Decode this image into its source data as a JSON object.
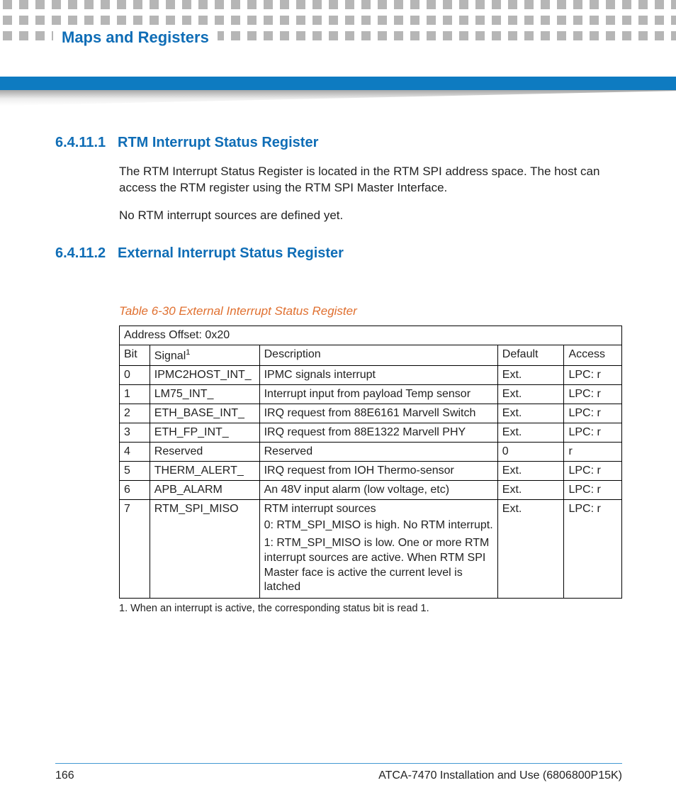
{
  "header": {
    "section_title": "Maps and Registers"
  },
  "sections": [
    {
      "number": "6.4.11.1",
      "title": "RTM Interrupt Status Register",
      "paragraphs": [
        "The RTM Interrupt Status Register is located in the RTM SPI address space. The host can access the RTM register using the RTM SPI Master Interface.",
        "No RTM interrupt sources are defined yet."
      ]
    },
    {
      "number": "6.4.11.2",
      "title": "External Interrupt Status Register",
      "paragraphs": []
    }
  ],
  "table": {
    "caption": "Table 6-30 External Interrupt Status Register",
    "address_offset": "Address Offset: 0x20",
    "columns": {
      "bit": "Bit",
      "signal": "Signal",
      "signal_sup": "1",
      "description": "Description",
      "default": "Default",
      "access": "Access"
    },
    "rows": [
      {
        "bit": "0",
        "signal": "IPMC2HOST_INT_",
        "description": "IPMC signals interrupt",
        "default": "Ext.",
        "access": "LPC: r"
      },
      {
        "bit": "1",
        "signal": "LM75_INT_",
        "description": "Interrupt input from payload Temp sensor",
        "default": "Ext.",
        "access": "LPC: r"
      },
      {
        "bit": "2",
        "signal": "ETH_BASE_INT_",
        "description": "IRQ request from 88E6161 Marvell Switch",
        "default": "Ext.",
        "access": "LPC: r"
      },
      {
        "bit": "3",
        "signal": "ETH_FP_INT_",
        "description": "IRQ request from 88E1322 Marvell PHY",
        "default": "Ext.",
        "access": "LPC: r"
      },
      {
        "bit": "4",
        "signal": "Reserved",
        "description": "Reserved",
        "default": "0",
        "access": " r"
      },
      {
        "bit": "5",
        "signal": "THERM_ALERT_",
        "description": "IRQ request from IOH Thermo-sensor",
        "default": "Ext.",
        "access": "LPC: r"
      },
      {
        "bit": "6",
        "signal": "APB_ALARM",
        "description": "An 48V input alarm (low voltage, etc)",
        "default": "Ext.",
        "access": "LPC: r"
      },
      {
        "bit": "7",
        "signal": "RTM_SPI_MISO",
        "description": "RTM interrupt sources",
        "sub1": "0: RTM_SPI_MISO is high. No RTM interrupt.",
        "sub2": "1: RTM_SPI_MISO is low. One or more RTM interrupt sources are active. When RTM SPI Master face is active the current level is latched",
        "default": "Ext.",
        "access": "LPC: r"
      }
    ],
    "footnote": "1. When an interrupt is active, the corresponding status bit is read 1."
  },
  "footer": {
    "page_number": "166",
    "doc_title": "ATCA-7470 Installation and Use (6806800P15K)"
  }
}
